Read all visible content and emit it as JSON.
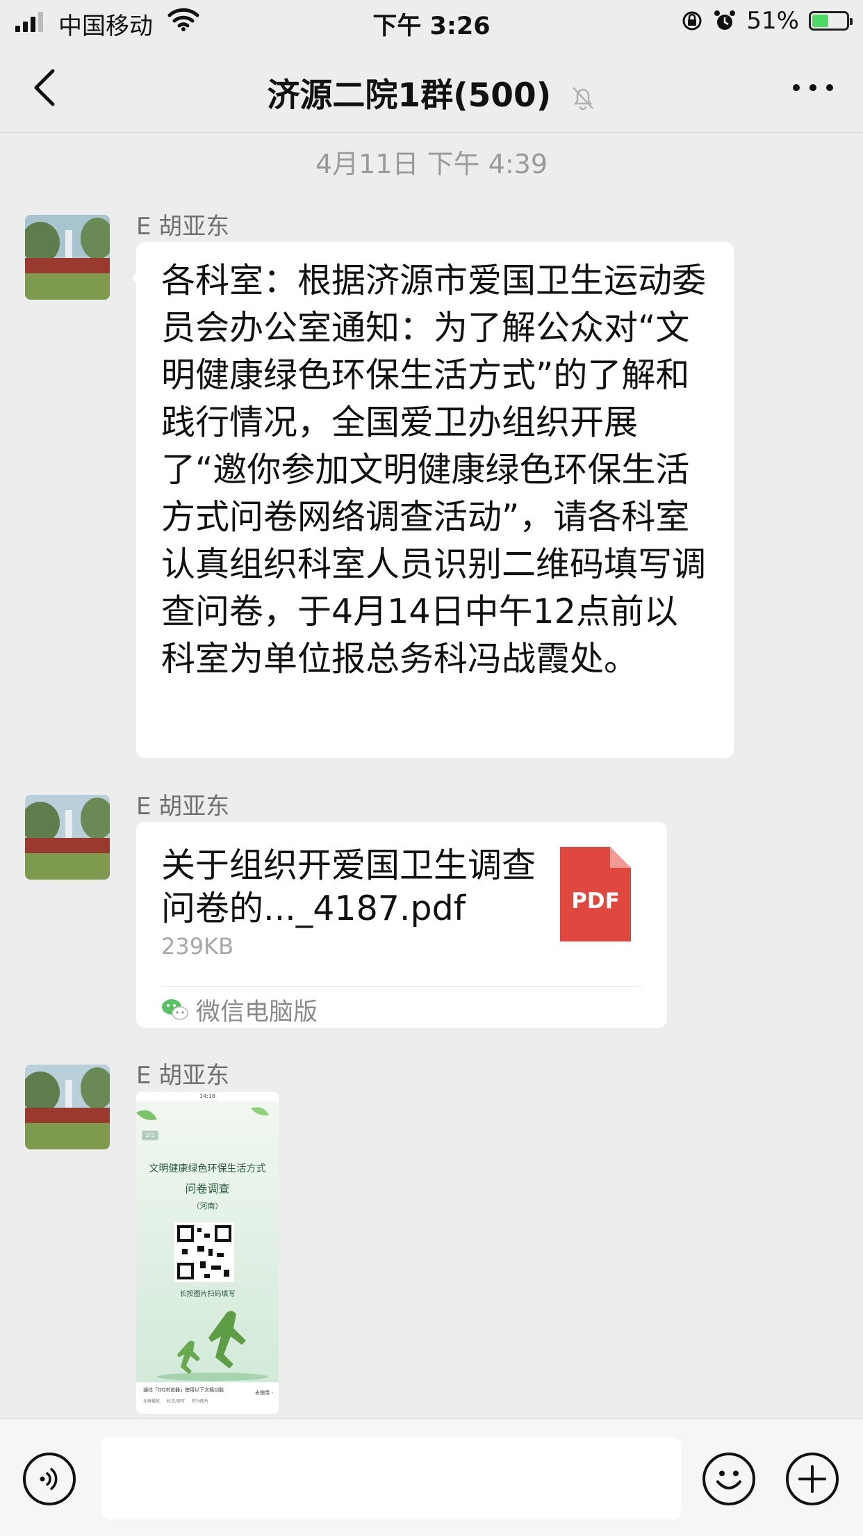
{
  "status_bar": {
    "carrier": "中国移动",
    "time": "下午 3:26",
    "battery_percent": "51%",
    "battery_level": 0.51,
    "icons": [
      "signal-icon",
      "wifi-icon",
      "orientation-lock-icon",
      "alarm-icon",
      "battery-charging-icon"
    ]
  },
  "nav": {
    "title": "济源二院1群(500)",
    "icons": [
      "back-chevron-icon",
      "mute-bell-icon",
      "more-dots-icon"
    ]
  },
  "chat": {
    "timestamp": "4月11日 下午 4:39",
    "messages": [
      {
        "sender": "E 胡亚东",
        "type": "text",
        "text": "各科室：根据济源市爱国卫生运动委员会办公室通知：为了解公众对“文明健康绿色环保生活方式”的了解和践行情况，全国爱卫办组织开展了“邀你参加文明健康绿色环保生活方式问卷网络调查活动”，请各科室认真组织科室人员识别二维码填写调查问卷，于4月14日中午12点前以科室为单位报总务科冯战霞处。"
      },
      {
        "sender": "E 胡亚东",
        "type": "file",
        "file_name": "关于组织开爱国卫生调查问卷的..._4187.pdf",
        "file_size": "239KB",
        "file_badge": "PDF",
        "source": "微信电脑版"
      },
      {
        "sender": "E 胡亚东",
        "type": "image",
        "image": {
          "phone_time": "14:18",
          "page_indicator": "2/2",
          "title_line1": "文明健康绿色环保生活方式",
          "title_line2": "问卷调查",
          "region": "（河南）",
          "caption": "长按图片扫码填写",
          "footer_text": "通过「QQ浏览器」使用以下文档功能",
          "footer_action": "去使用 ›",
          "footer_items": [
            "全屏播放",
            "标注/填写",
            "转为图片"
          ]
        }
      }
    ]
  },
  "input_bar": {
    "value": "",
    "icons": [
      "voice-icon",
      "emoji-icon",
      "plus-icon"
    ]
  },
  "colors": {
    "background": "#ededed",
    "bubble": "#ffffff",
    "pdf_red": "#e0483f",
    "battery_green": "#4cd964"
  }
}
